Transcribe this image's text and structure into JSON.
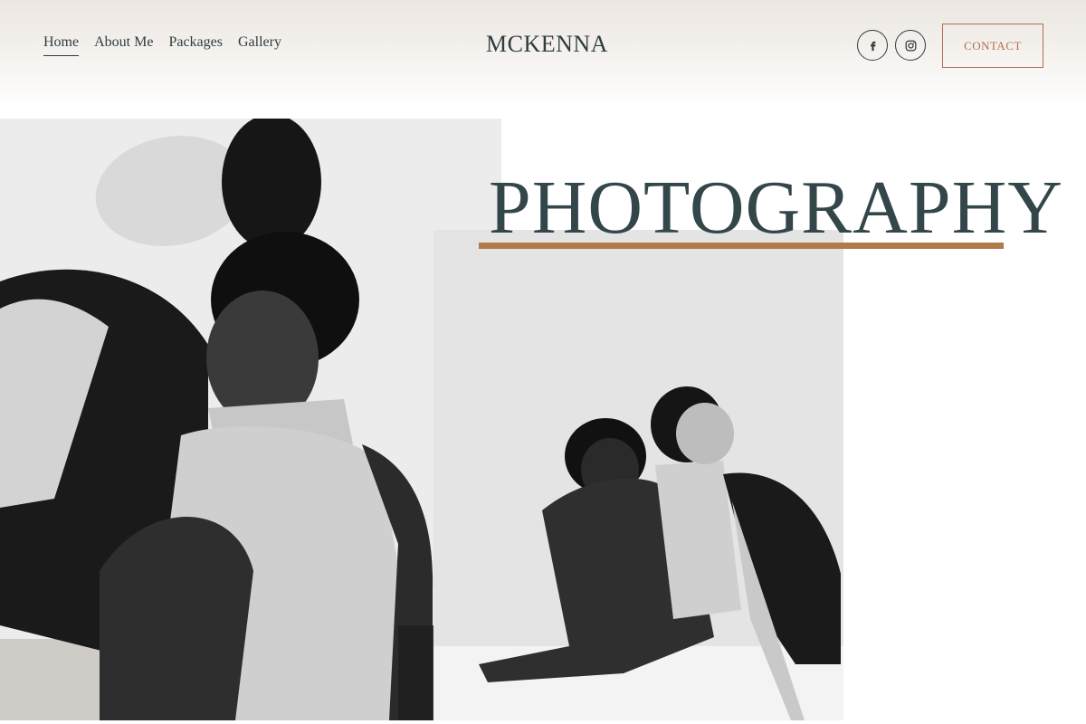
{
  "nav": {
    "items": [
      {
        "label": "Home",
        "active": true
      },
      {
        "label": "About Me",
        "active": false
      },
      {
        "label": "Packages",
        "active": false
      },
      {
        "label": "Gallery",
        "active": false
      }
    ]
  },
  "brand": {
    "name": "MCKENNA"
  },
  "social": {
    "icons": [
      "facebook-icon",
      "instagram-icon"
    ]
  },
  "contact": {
    "label": "CONTACT"
  },
  "hero": {
    "headline": "PHOTOGRAPHY"
  },
  "colors": {
    "text_dark": "#2f3d3f",
    "accent_copper": "#b06f4f",
    "underline_gold": "#b07a4b",
    "header_gradient_top": "#ebe6e1"
  }
}
